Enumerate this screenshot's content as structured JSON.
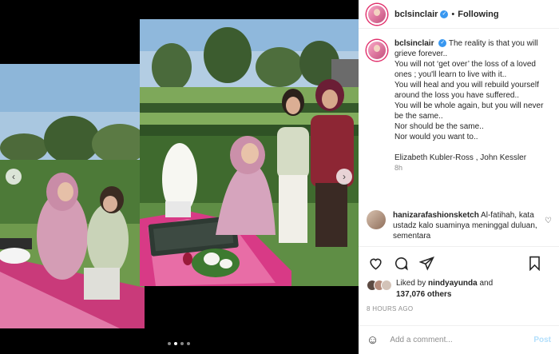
{
  "post": {
    "username": "bclsinclair",
    "follow_sep": "•",
    "follow_status": "Following",
    "caption": {
      "username": "bclsinclair",
      "lines": [
        "The reality is that you will grieve forever..",
        "You will not ‘get over’ the loss of a loved ones ; you'll learn to live with it..",
        "You will heal and you will rebuild yourself around the loss you have suffered..",
        "You will be whole again, but you will never be the same..",
        "Nor should be the same..",
        "Nor would you want to.."
      ],
      "credit": "Elizabeth Kubler-Ross , John Kessler",
      "time": "8h"
    },
    "comment": {
      "username": "hanizarafashionsketch",
      "text": "Al-fatihah, kata ustadz kalo suaminya meninggal duluan, sementara"
    },
    "likes": {
      "prefix": "Liked by",
      "user": "nindyayunda",
      "joiner": "and",
      "count": "137,076 others"
    },
    "posted_ago": "8 HOURS AGO",
    "add_comment_placeholder": "Add a comment...",
    "post_button": "Post"
  },
  "media": {
    "prev_arrow": "‹",
    "next_arrow": "›",
    "slide_count": 4,
    "active_slide": 1
  },
  "icons": {
    "like": "heart-icon",
    "comment": "comment-icon",
    "share": "send-icon",
    "save": "bookmark-icon",
    "emoji": "smile-icon"
  },
  "colors": {
    "verified": "#3897f0",
    "post_disabled": "#b2dffc"
  }
}
